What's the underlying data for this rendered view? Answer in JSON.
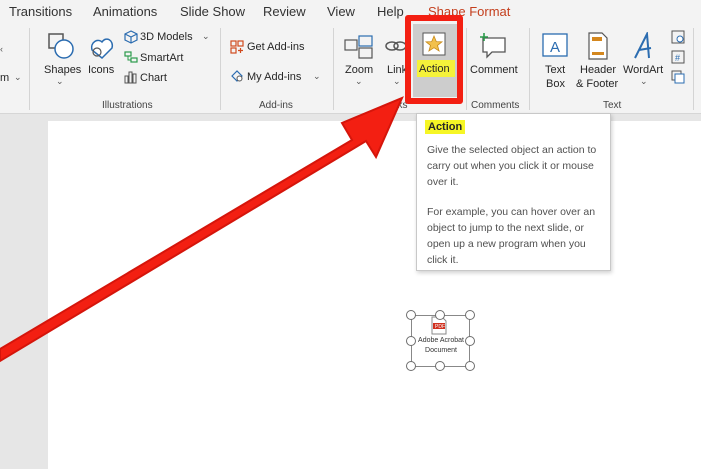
{
  "tabs": {
    "transitions": "Transitions",
    "animations": "Animations",
    "slide_show": "Slide Show",
    "review": "Review",
    "view": "View",
    "help": "Help",
    "shape_format": "Shape Format"
  },
  "ribbon": {
    "left_partial": "m",
    "illustrations": {
      "shapes": "Shapes",
      "icons": "Icons",
      "models_3d": "3D Models",
      "smartart": "SmartArt",
      "chart": "Chart",
      "group_label": "Illustrations"
    },
    "addins": {
      "get_addins": "Get Add-ins",
      "my_addins": "My Add-ins",
      "group_label": "Add-ins"
    },
    "links": {
      "zoom": "Zoom",
      "link": "Link",
      "action": "Action",
      "group_label_partial": "nks"
    },
    "comments": {
      "comment": "Comment",
      "group_label": "Comments"
    },
    "text": {
      "text_box_1": "Text",
      "text_box_2": "Box",
      "header_footer_1": "Header",
      "header_footer_2": "& Footer",
      "wordart": "WordArt",
      "group_label": "Text"
    }
  },
  "tooltip": {
    "title": "Action",
    "para1": "Give the selected object an action to carry out when you click it or mouse over it.",
    "para2": "For example, you can hover over an object to jump to the next slide, or open up a new program when you click it."
  },
  "slide_object": {
    "line1": "Adobe Acrobat",
    "line2": "Document",
    "icon_text": "PDF"
  },
  "colors": {
    "annotation_red": "#f31f12",
    "highlight_yellow": "#f5f23a",
    "context_tab": "#c43e1c",
    "ribbon_bg": "#f3f3f3"
  }
}
